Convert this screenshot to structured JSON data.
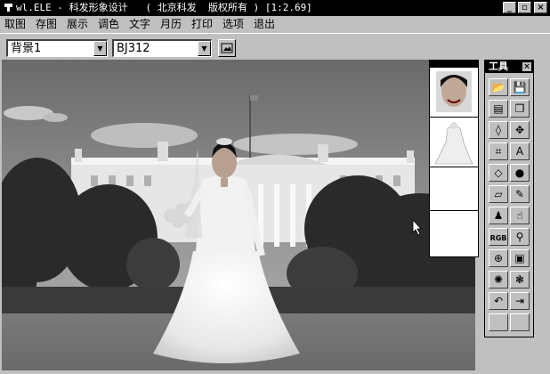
{
  "window": {
    "title": "wl.ELE - 科发形象设计   ( 北京科发  版权所有 ) [1:2.69]",
    "controls": {
      "minimize": "_",
      "restore": "▫",
      "close": "×"
    }
  },
  "menu": [
    "取图",
    "存图",
    "展示",
    "调色",
    "文字",
    "月历",
    "打印",
    "选项",
    "退出"
  ],
  "toolbar": {
    "background_select": "背景1",
    "style_select": "BJ312"
  },
  "palette": {
    "title": "工具",
    "close": "×",
    "tools": [
      {
        "icon": "open-folder-icon",
        "glyph": "📂"
      },
      {
        "icon": "save-disk-icon",
        "glyph": "💾"
      },
      {
        "icon": "print-icon",
        "glyph": "▤"
      },
      {
        "icon": "copy-icon",
        "glyph": "❐"
      },
      {
        "icon": "lasso-icon",
        "glyph": "◊"
      },
      {
        "icon": "move-icon",
        "glyph": "✥"
      },
      {
        "icon": "crop-icon",
        "glyph": "⌗"
      },
      {
        "icon": "text-icon",
        "glyph": "A"
      },
      {
        "icon": "drop-icon",
        "glyph": "◇"
      },
      {
        "icon": "brush-blob-icon",
        "glyph": "●"
      },
      {
        "icon": "eraser-icon",
        "glyph": "▱"
      },
      {
        "icon": "pen-icon",
        "glyph": "✎"
      },
      {
        "icon": "stamp-icon",
        "glyph": "♟"
      },
      {
        "icon": "smudge-icon",
        "glyph": "☝"
      },
      {
        "icon": "rgb-icon",
        "glyph": "RGB"
      },
      {
        "icon": "bulb-icon",
        "glyph": "⚲"
      },
      {
        "icon": "zoom-icon",
        "glyph": "⊕"
      },
      {
        "icon": "frame-icon",
        "glyph": "▣"
      },
      {
        "icon": "effect-gear-icon",
        "glyph": "✺"
      },
      {
        "icon": "filter-icon",
        "glyph": "❃"
      },
      {
        "icon": "undo-icon",
        "glyph": "↶"
      },
      {
        "icon": "exit-door-icon",
        "glyph": "⇥"
      },
      {
        "icon": "empty-icon",
        "glyph": ""
      },
      {
        "icon": "empty-icon",
        "glyph": ""
      }
    ]
  },
  "colors": {
    "window": "#c0c0c0",
    "titlebar": "#000000"
  }
}
